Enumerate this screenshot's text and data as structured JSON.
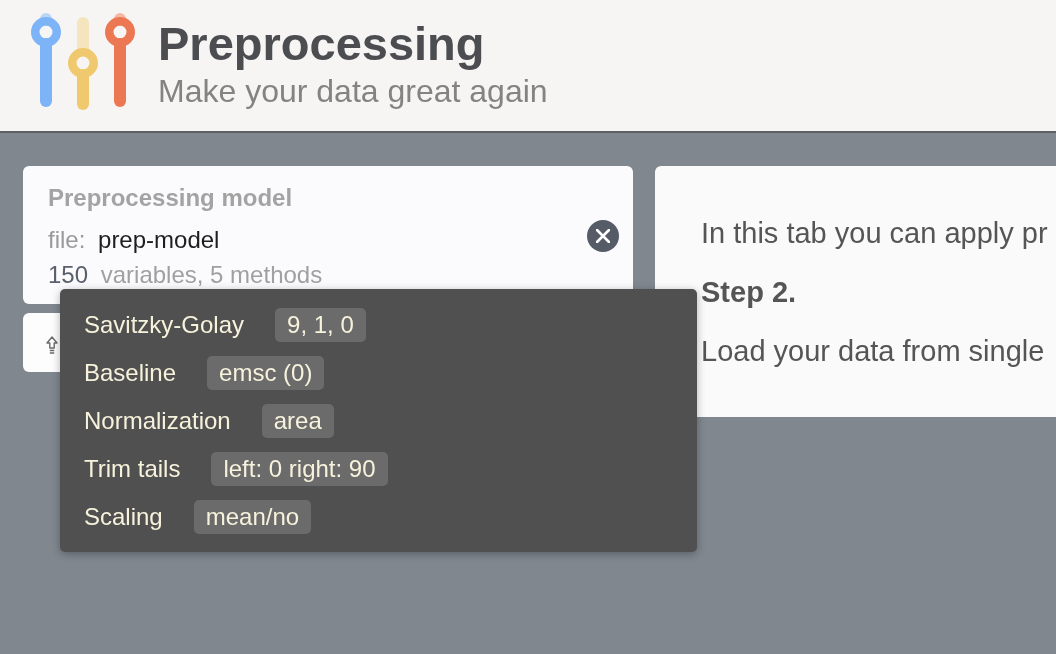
{
  "header": {
    "title": "Preprocessing",
    "subtitle": "Make your data great again"
  },
  "model_card": {
    "heading": "Preprocessing model",
    "file_label": "file:",
    "file_name": "prep-model",
    "variable_count": "150",
    "summary": "variables, 5 methods"
  },
  "info_panel": {
    "paragraphs": [
      {
        "kind": "text",
        "text": "In this tab you can apply pr"
      },
      {
        "kind": "heading",
        "text": "Step 2."
      },
      {
        "kind": "text",
        "text": "Load your data from single"
      }
    ]
  },
  "methods_tooltip": {
    "methods": [
      {
        "name": "Savitzky-Golay",
        "value": "9, 1, 0"
      },
      {
        "name": "Baseline",
        "value": "emsc (0)"
      },
      {
        "name": "Normalization",
        "value": "area"
      },
      {
        "name": "Trim tails",
        "value": "left: 0 right: 90"
      },
      {
        "name": "Scaling",
        "value": "mean/no"
      }
    ]
  }
}
